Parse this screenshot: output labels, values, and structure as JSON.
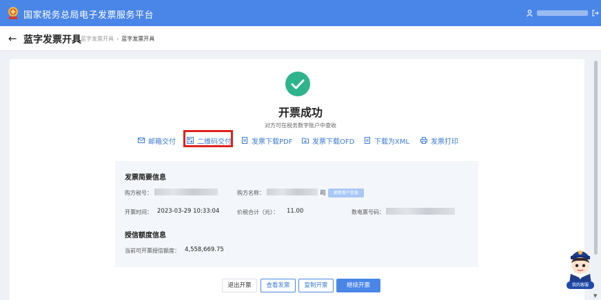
{
  "topbar": {
    "title": "国家税务总局电子发票服务平台",
    "logo_icon": "tax-emblem-icon",
    "user_icon": "user-icon",
    "exit_icon": "exit-icon"
  },
  "header": {
    "back_icon": "back-arrow-icon",
    "title": "蓝字发票开具",
    "breadcrumb": [
      "蓝字发票开具",
      "蓝字发票开具"
    ],
    "breadcrumb_separator": "›"
  },
  "result": {
    "icon": "success-check-icon",
    "title": "开票成功",
    "subtitle": "对方可在税务数字账户中查收"
  },
  "actions": [
    {
      "label": "邮箱交付",
      "icon": "mail-icon"
    },
    {
      "label": "二维码交付",
      "icon": "qrcode-icon",
      "highlighted": true
    },
    {
      "label": "发票下载PDF",
      "icon": "document-download-icon"
    },
    {
      "label": "发票下载OFD",
      "icon": "folder-download-icon"
    },
    {
      "label": "下载为XML",
      "icon": "document-download-icon"
    },
    {
      "label": "发票打印",
      "icon": "printer-icon"
    }
  ],
  "summary": {
    "title": "发票简要信息",
    "buyer_tax_no_label": "购方税号：",
    "buyer_name_label": "购方名称：",
    "buyer_name_suffix": "司",
    "update_button": "更新客户信息",
    "issue_time_label": "开票时间：",
    "issue_time": "2023-03-29 10:33:04",
    "total_label": "价税合计（元）：",
    "total": "11.00",
    "invoice_no_label": "数电票号码："
  },
  "credit": {
    "title": "授信额度信息",
    "available_label": "当前可开票授信额度：",
    "available": "4,558,669.75"
  },
  "buttons": {
    "exit": "退出开票",
    "view": "查看发票",
    "copy": "复制开票",
    "continue": "继续开票"
  },
  "mascot": {
    "label": "我的客服"
  },
  "colors": {
    "brand": "#4a86e8",
    "success": "#2db48c",
    "highlight": "#e0201b",
    "link": "#3a7bd5"
  }
}
